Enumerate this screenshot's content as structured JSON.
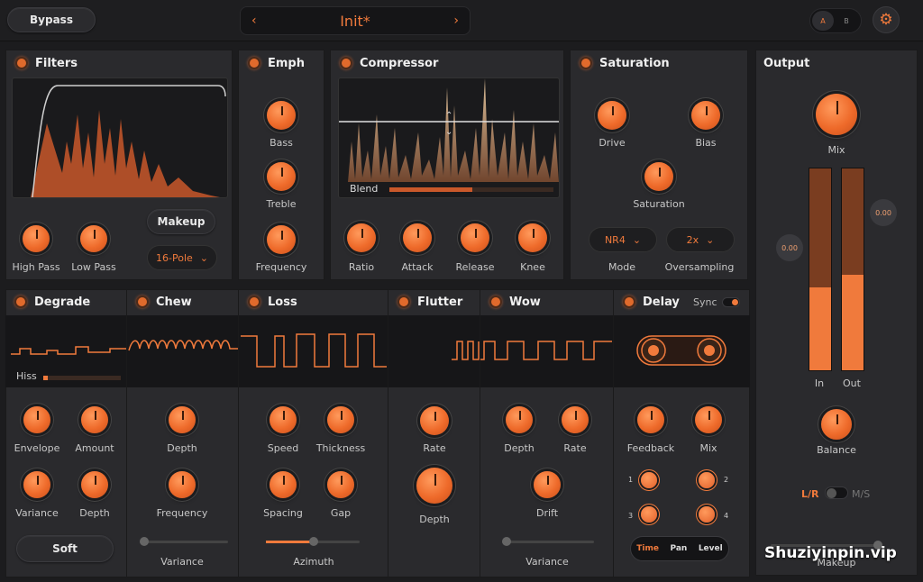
{
  "top": {
    "bypass": "Bypass",
    "preset": "Init*",
    "prev": "‹",
    "next": "›",
    "ab_a": "A",
    "ab_b": "B"
  },
  "filters": {
    "title": "Filters",
    "knobs": [
      "High Pass",
      "Low Pass"
    ],
    "makeup": "Makeup",
    "pole": "16-Pole"
  },
  "emph": {
    "title": "Emph",
    "knobs": [
      "Bass",
      "Treble",
      "Frequency"
    ]
  },
  "compressor": {
    "title": "Compressor",
    "blend": "Blend",
    "knobs": [
      "Ratio",
      "Attack",
      "Release",
      "Knee"
    ]
  },
  "saturation": {
    "title": "Saturation",
    "knobs": [
      "Drive",
      "Bias",
      "Saturation"
    ],
    "mode_value": "NR4",
    "mode_label": "Mode",
    "os_value": "2x",
    "os_label": "Oversampling"
  },
  "output": {
    "title": "Output",
    "mix": "Mix",
    "in": "In",
    "out": "Out",
    "in_val": "0.00",
    "out_val": "0.00",
    "balance": "Balance",
    "lr": "L/R",
    "ms": "M/S",
    "makeup": "Makeup"
  },
  "degrade": {
    "title": "Degrade",
    "hiss": "Hiss",
    "knobs": [
      "Envelope",
      "Amount",
      "Variance",
      "Depth"
    ],
    "soft": "Soft"
  },
  "chew": {
    "title": "Chew",
    "knobs": [
      "Depth",
      "Frequency"
    ],
    "variance": "Variance"
  },
  "loss": {
    "title": "Loss",
    "knobs": [
      "Speed",
      "Thickness",
      "Spacing",
      "Gap"
    ],
    "azimuth": "Azimuth"
  },
  "flutter": {
    "title": "Flutter",
    "knobs": [
      "Rate",
      "Depth"
    ]
  },
  "wow": {
    "title": "Wow",
    "knobs": [
      "Depth",
      "Rate",
      "Drift"
    ],
    "variance": "Variance"
  },
  "delay": {
    "title": "Delay",
    "sync": "Sync",
    "knobs": [
      "Feedback",
      "Mix"
    ],
    "heads": [
      "1",
      "2",
      "3",
      "4"
    ],
    "tabs": [
      "Time",
      "Pan",
      "Level"
    ]
  },
  "watermark": "Shuziyinpin.vip",
  "colors": {
    "accent": "#f07a3c",
    "panel": "#2a2a2d",
    "bg": "#1c1c1e"
  }
}
